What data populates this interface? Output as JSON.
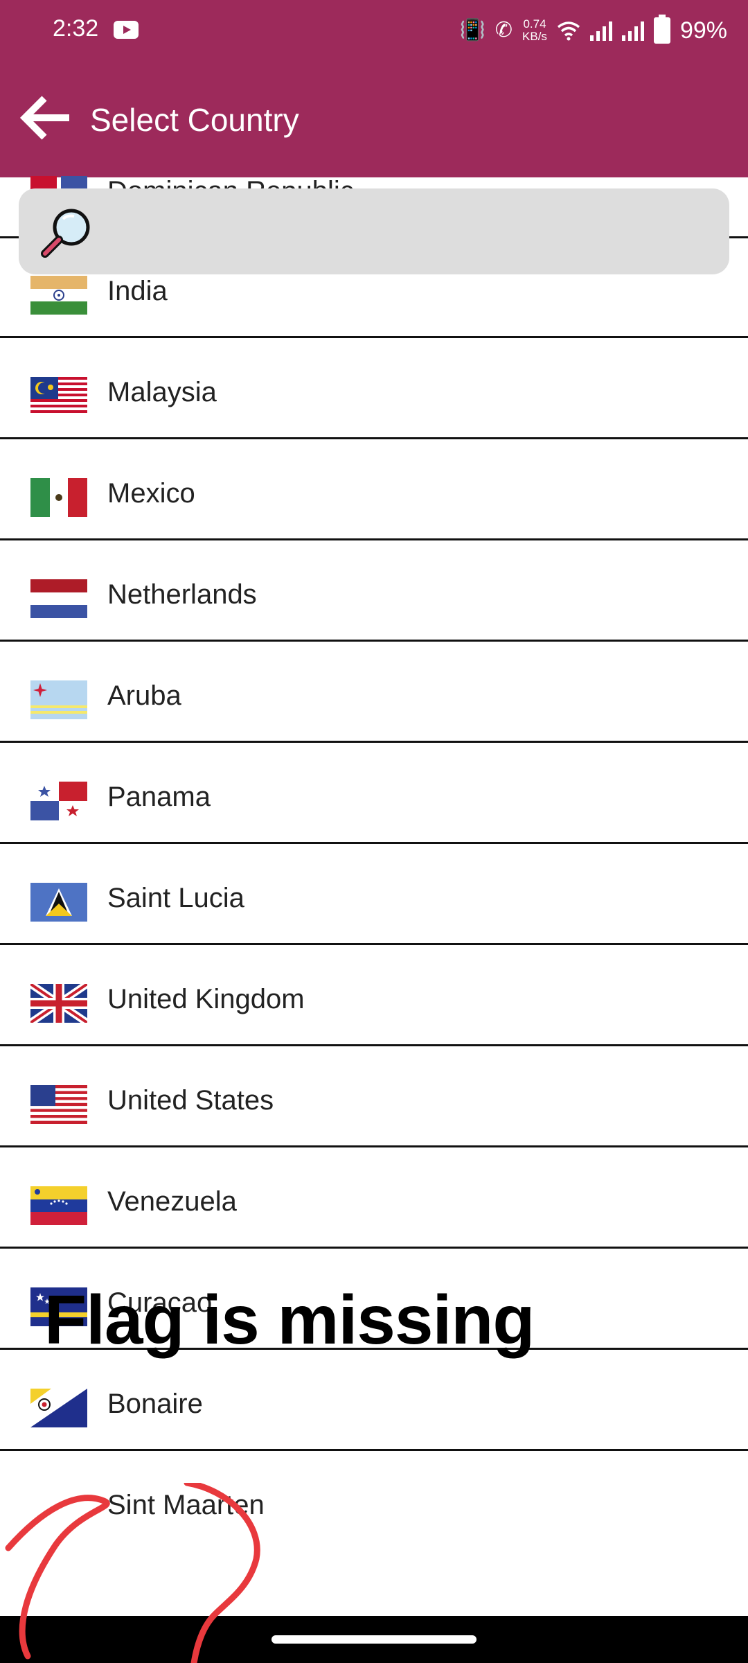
{
  "status_bar": {
    "time": "2:32",
    "net_speed_value": "0.74",
    "net_speed_unit": "KB/s",
    "battery": "99%",
    "icons": [
      "youtube-icon",
      "vibrate-icon",
      "wifi-calling-icon",
      "wifi-icon",
      "signal-icon",
      "battery-icon"
    ]
  },
  "header": {
    "title": "Select Country",
    "back_icon": "arrow-left-icon"
  },
  "search": {
    "placeholder": "",
    "icon": "magnifier-icon"
  },
  "countries": [
    {
      "name": "Dominican Republic",
      "flag": "dominican-republic"
    },
    {
      "name": "India",
      "flag": "india"
    },
    {
      "name": "Malaysia",
      "flag": "malaysia"
    },
    {
      "name": "Mexico",
      "flag": "mexico"
    },
    {
      "name": "Netherlands",
      "flag": "netherlands"
    },
    {
      "name": "Aruba",
      "flag": "aruba"
    },
    {
      "name": "Panama",
      "flag": "panama"
    },
    {
      "name": "Saint Lucia",
      "flag": "saint-lucia"
    },
    {
      "name": "United Kingdom",
      "flag": "united-kingdom"
    },
    {
      "name": "United States",
      "flag": "united-states"
    },
    {
      "name": "Venezuela",
      "flag": "venezuela"
    },
    {
      "name": "Curaçao",
      "flag": "curacao"
    },
    {
      "name": "Bonaire",
      "flag": "bonaire"
    },
    {
      "name": "Sint Maarten",
      "flag": ""
    }
  ],
  "annotation": {
    "text": "Flag is missing",
    "mark_color": "#e8393d"
  },
  "colors": {
    "brand": "#9d2a5b",
    "search_bg": "#dddddd"
  }
}
